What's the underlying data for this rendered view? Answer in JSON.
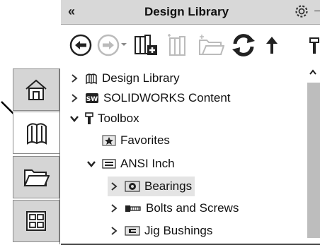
{
  "panel": {
    "collapse_glyph": "«",
    "title": "Design Library",
    "pin_glyph": "→"
  },
  "toolbar": {
    "buttons": [
      {
        "icon": "back-arrow-icon"
      },
      {
        "icon": "forward-arrow-icon"
      },
      {
        "icon": "add-to-library-icon"
      },
      {
        "icon": "add-file-location-icon"
      },
      {
        "icon": "create-new-folder-icon"
      },
      {
        "icon": "refresh-icon"
      },
      {
        "icon": "up-one-level-icon"
      }
    ]
  },
  "left_tabs": [
    {
      "icon": "home-icon",
      "active": false
    },
    {
      "icon": "design-library-icon",
      "active": true
    },
    {
      "icon": "file-explorer-icon",
      "active": false
    },
    {
      "icon": "view-palette-icon",
      "active": false
    }
  ],
  "tree": {
    "items": [
      {
        "label": "Design Library",
        "icon": "design-library-books-icon",
        "expanded": false
      },
      {
        "label": "SOLIDWORKS Content",
        "icon": "solidworks-logo-icon",
        "expanded": false
      },
      {
        "label": "Toolbox",
        "icon": "toolbox-icon",
        "expanded": true
      },
      {
        "label": "Favorites",
        "icon": "favorites-star-icon",
        "expanded": null
      },
      {
        "label": "ANSI Inch",
        "icon": "standard-folder-icon",
        "expanded": true
      },
      {
        "label": "Bearings",
        "icon": "bearings-folder-icon",
        "expanded": false,
        "selected": true
      },
      {
        "label": "Bolts and Screws",
        "icon": "bolts-folder-icon",
        "expanded": false
      },
      {
        "label": "Jig Bushings",
        "icon": "bushings-folder-icon",
        "expanded": false
      }
    ]
  }
}
